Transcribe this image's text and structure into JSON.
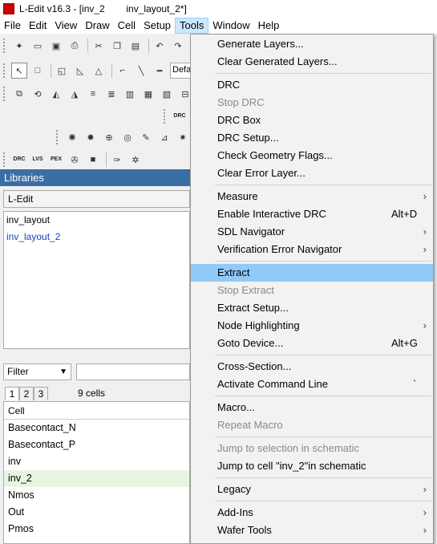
{
  "window": {
    "title": "L-Edit v16.3 - [inv_2        inv_layout_2*]"
  },
  "menubar": [
    "File",
    "Edit",
    "View",
    "Draw",
    "Cell",
    "Setup",
    "Tools",
    "Window",
    "Help"
  ],
  "toolbar": {
    "layer_combo_value": "Defa",
    "verify_buttons": [
      "DRC",
      "LVS",
      "PEX"
    ],
    "drc_small": "DRC"
  },
  "libraries": {
    "header": "Libraries",
    "combo_value": "L-Edit",
    "items": [
      "inv_layout",
      "inv_layout_2"
    ]
  },
  "cells": {
    "filter_value": "Filter",
    "tabs": [
      "1",
      "2",
      "3"
    ],
    "count": "9 cells",
    "column_header": "Cell",
    "rows": [
      "Basecontact_N",
      "Basecontact_P",
      "inv",
      "inv_2",
      "Nmos",
      "Out",
      "Pmos"
    ]
  },
  "tools_menu": {
    "items": [
      {
        "label": "Generate Layers...",
        "enabled": true
      },
      {
        "label": "Clear Generated Layers...",
        "enabled": true
      },
      {
        "label": "DRC",
        "enabled": true
      },
      {
        "label": "Stop DRC",
        "enabled": false
      },
      {
        "label": "DRC Box",
        "enabled": true
      },
      {
        "label": "DRC Setup...",
        "enabled": true
      },
      {
        "label": "Check Geometry Flags...",
        "enabled": true
      },
      {
        "label": "Clear Error Layer...",
        "enabled": true
      },
      {
        "label": "Measure",
        "enabled": true,
        "submenu": true
      },
      {
        "label": "Enable Interactive DRC",
        "enabled": true,
        "shortcut": "Alt+D"
      },
      {
        "label": "SDL Navigator",
        "enabled": true,
        "submenu": true
      },
      {
        "label": "Verification Error Navigator",
        "enabled": true,
        "submenu": true
      },
      {
        "label": "Extract",
        "enabled": true,
        "highlighted": true
      },
      {
        "label": "Stop Extract",
        "enabled": false
      },
      {
        "label": "Extract Setup...",
        "enabled": true
      },
      {
        "label": "Node Highlighting",
        "enabled": true,
        "submenu": true
      },
      {
        "label": "Goto Device...",
        "enabled": true,
        "shortcut": "Alt+G"
      },
      {
        "label": "Cross-Section...",
        "enabled": true
      },
      {
        "label": "Activate Command Line",
        "enabled": true,
        "shortcut": "`"
      },
      {
        "label": "Macro...",
        "enabled": true
      },
      {
        "label": "Repeat Macro",
        "enabled": false
      },
      {
        "label": "Jump to selection in schematic",
        "enabled": false
      },
      {
        "label": "Jump to cell \"inv_2\"in schematic",
        "enabled": true
      },
      {
        "label": "Legacy",
        "enabled": true,
        "submenu": true
      },
      {
        "label": "Add-Ins",
        "enabled": true,
        "submenu": true
      },
      {
        "label": "Wafer Tools",
        "enabled": true,
        "submenu": true
      }
    ],
    "arrow_glyph": "›"
  },
  "colors": {
    "highlight": "#91c9f7",
    "library_header": "#3a6ea5",
    "selected_row": "#e8f5e0"
  }
}
